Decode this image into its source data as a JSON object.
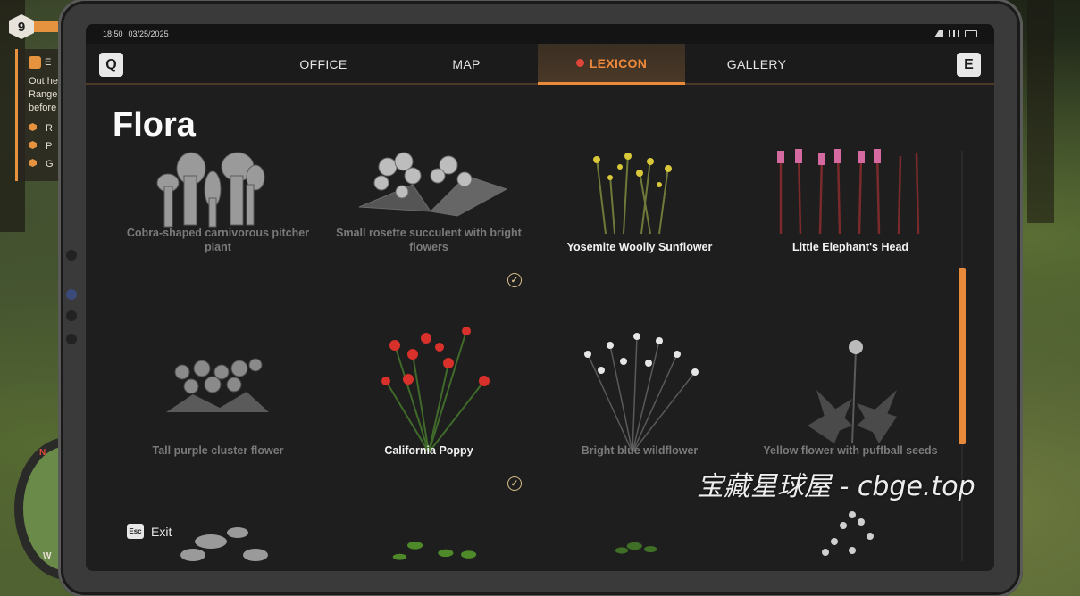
{
  "hud": {
    "level": "9",
    "quest_initial": "E",
    "quest_lines": [
      "Out he",
      "Ranger",
      "before"
    ],
    "quest_items": [
      "R",
      "P",
      "G"
    ],
    "compass_letters": [
      "N",
      "W"
    ]
  },
  "statusbar": {
    "time": "18:50",
    "date": "03/25/2025"
  },
  "tabs": {
    "left_key": "Q",
    "right_key": "E",
    "items": [
      {
        "label": "OFFICE",
        "active": false
      },
      {
        "label": "MAP",
        "active": false
      },
      {
        "label": "LEXICON",
        "active": true
      },
      {
        "label": "GALLERY",
        "active": false
      }
    ]
  },
  "page": {
    "title": "Flora"
  },
  "plants": [
    {
      "label": "Cobra-shaped carnivorous pitcher plant",
      "known": false,
      "icon": "pitcher-plant"
    },
    {
      "label": "Small rosette succulent with bright flowers",
      "known": false,
      "icon": "succulent"
    },
    {
      "label": "Yosemite Woolly Sunflower",
      "known": true,
      "icon": "yellow-flowers"
    },
    {
      "label": "Little Elephant's Head",
      "known": true,
      "icon": "pink-spikes"
    },
    {
      "label": "Tall purple cluster flower",
      "known": false,
      "icon": "cluster-flower"
    },
    {
      "label": "California Poppy",
      "known": true,
      "icon": "red-poppy"
    },
    {
      "label": "Bright blue wildflower",
      "known": false,
      "icon": "wildflower"
    },
    {
      "label": "Yellow flower with puffball seeds",
      "known": false,
      "icon": "dandelion"
    }
  ],
  "footer": {
    "esc_key": "Esc",
    "exit_label": "Exit"
  },
  "watermark": "宝藏星球屋 - cbge.top",
  "colors": {
    "accent": "#e88a3a",
    "known_text": "#f2f2f2",
    "unknown_text": "#7a7a7a"
  }
}
